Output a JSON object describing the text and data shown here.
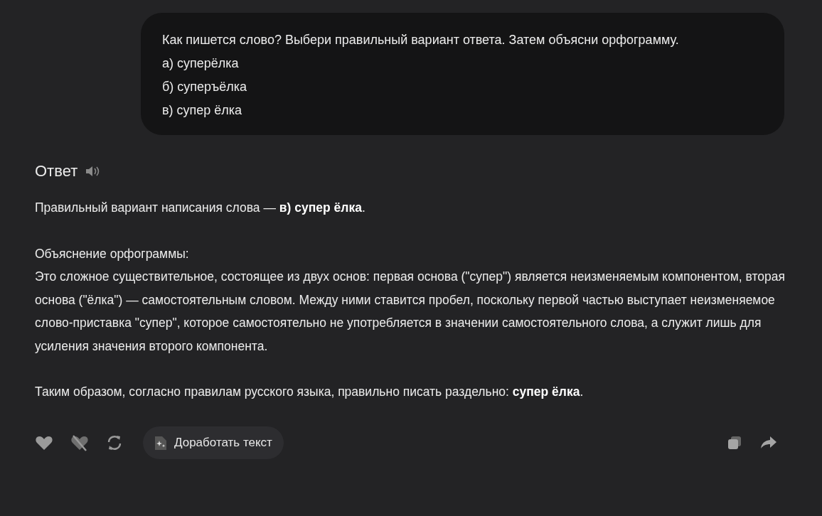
{
  "question": {
    "lines": [
      "Как пишется слово? Выбери правильный вариант ответа. Затем объясни орфограмму.",
      "а) суперёлка",
      "б) суперъёлка",
      "в) супер ёлка"
    ]
  },
  "answer": {
    "title": "Ответ",
    "paragraphs": [
      {
        "kind": "text",
        "text": "Правильный вариант написания слова — **в) супер ёлка**."
      },
      {
        "kind": "text",
        "text": "Объяснение орфограммы:\nЭто сложное существительное, состоящее из двух основ: первая основа (\"супер\") является неизменяемым компонентом, вторая основа (\"ёлка\") — самостоятельным словом. Между ними ставится пробел, поскольку первой частью выступает неизменяемое слово-приставка \"супер\", которое самостоятельно не употребляется в значении самостоятельного слова, а служит лишь для усиления значения второго компонента."
      },
      {
        "kind": "text",
        "text": "Таким образом, согласно правилам русского языка, правильно писать раздельно: **супер ёлка**."
      }
    ]
  },
  "actions": {
    "improve_button": "Доработать текст"
  }
}
